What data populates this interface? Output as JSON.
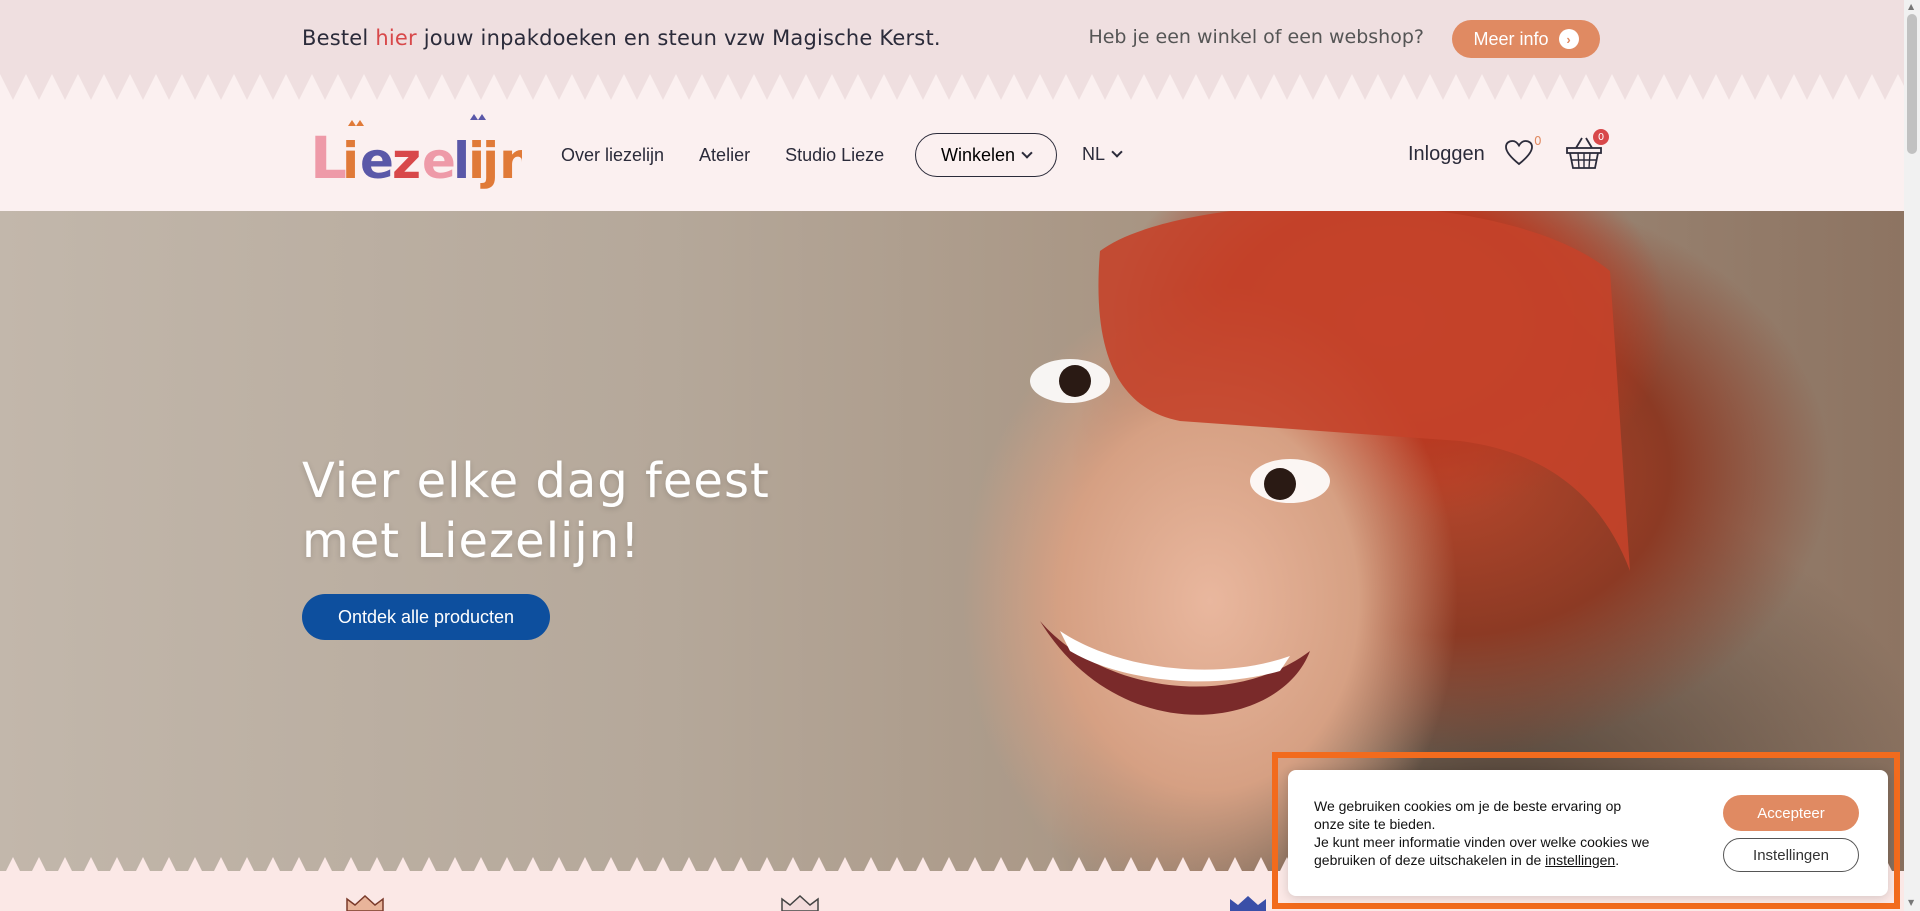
{
  "promo": {
    "text_before": "Bestel ",
    "text_highlight": "hier",
    "text_after": " jouw inpakdoeken en steun vzw Magische Kerst.",
    "shop_question": "Heb je een winkel of een webshop?",
    "button_label": "Meer info"
  },
  "header": {
    "logo_text": "Liezelijn",
    "nav": {
      "item1": "Over liezelijn",
      "item2": "Atelier",
      "item3": "Studio Lieze",
      "shop_label": "Winkelen",
      "language": "NL"
    },
    "login_label": "Inloggen",
    "wishlist_count": "0",
    "cart_count": "0"
  },
  "hero": {
    "title_line1": "Vier elke dag feest",
    "title_line2": "met Liezelijn!",
    "cta_label": "Ontdek alle producten"
  },
  "cookie": {
    "line1": "We gebruiken cookies om je de beste ervaring op onze site te bieden.",
    "line2_before": "Je kunt meer informatie vinden over welke cookies we gebruiken of deze uitschakelen in de ",
    "line2_link": "instellingen",
    "line2_after": ".",
    "accept_label": "Accepteer",
    "settings_label": "Instellingen"
  },
  "colors": {
    "promo_bg": "#efdfe0",
    "accent_orange": "#e08a62",
    "cta_blue": "#0d4f9e",
    "highlight_red": "#d8484a",
    "cookie_outline": "#f26b1d"
  }
}
